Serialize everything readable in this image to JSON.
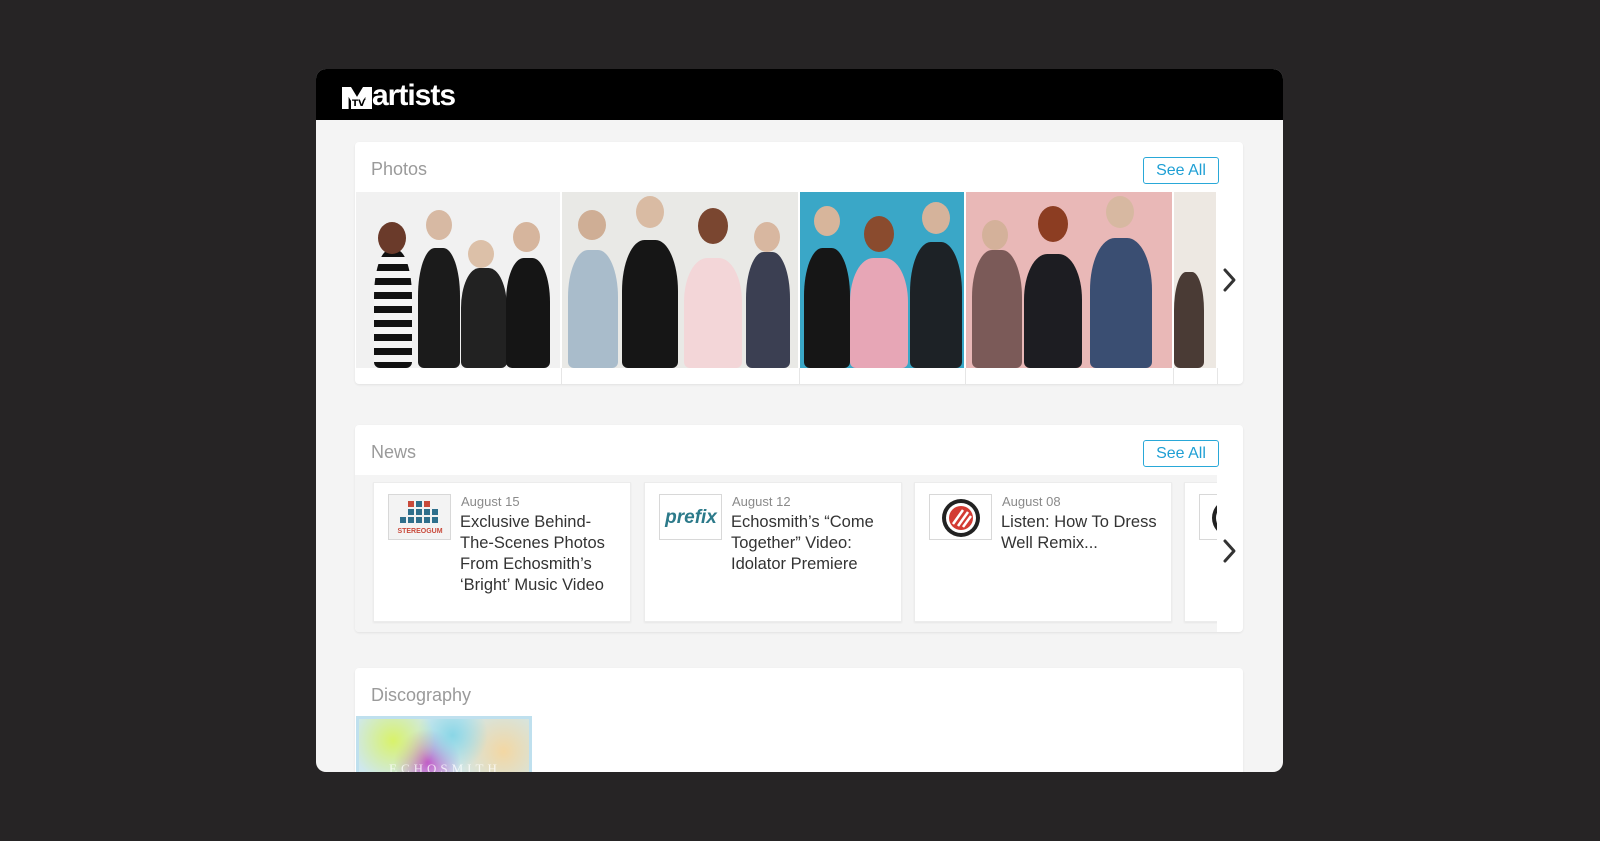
{
  "app": {
    "logo_text": "artists",
    "logo_badge": "TV"
  },
  "photos": {
    "title": "Photos",
    "see_all": "See All",
    "images": [
      "band-photo-1",
      "band-photo-2",
      "band-photo-3",
      "band-photo-4",
      "band-photo-5"
    ]
  },
  "news": {
    "title": "News",
    "see_all": "See All",
    "items": [
      {
        "source": "STEREOGUM",
        "date": "August 15",
        "headline": "Exclusive Behind-The-Scenes Photos From Echosmith’s ‘Bright’ Music Video"
      },
      {
        "source": "prefix",
        "date": "August 12",
        "headline": "Echosmith’s “Come Together” Video: Idolator Premiere"
      },
      {
        "source": "pitchfork",
        "date": "August 08",
        "headline": "Listen: How To Dress Well Remix..."
      }
    ]
  },
  "discography": {
    "title": "Discography",
    "album_text": "ECHOSMITH"
  },
  "colors": {
    "accent": "#1e9fd4",
    "topbar": "#000000",
    "background": "#262425"
  },
  "icons": {
    "next": "chevron-right-icon"
  }
}
